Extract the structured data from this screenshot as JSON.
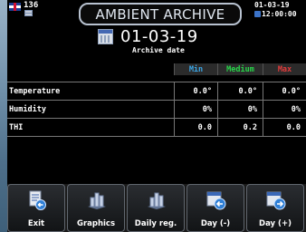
{
  "header": {
    "unit_number": "136",
    "title": "AMBIENT ARCHIVE",
    "date": "01-03-19",
    "time": "12:00:00"
  },
  "archive": {
    "date": "01-03-19",
    "caption": "Archive date"
  },
  "table": {
    "columns": [
      "Min",
      "Medium",
      "Max"
    ],
    "column_colors": [
      "#3aa6e6",
      "#28d64a",
      "#e23b3b"
    ],
    "rows": [
      {
        "label": "Temperature",
        "min": "0.0°",
        "medium": "0.0°",
        "max": "0.0°"
      },
      {
        "label": "Humidity",
        "min": "0%",
        "medium": "0%",
        "max": "0%"
      },
      {
        "label": "THI",
        "min": "0.0",
        "medium": "0.2",
        "max": "0.0"
      }
    ]
  },
  "toolbar": {
    "buttons": [
      {
        "label": "Exit",
        "icon": "exit-document-icon"
      },
      {
        "label": "Graphics",
        "icon": "graphics-bars-icon"
      },
      {
        "label": "Daily reg.",
        "icon": "daily-register-bars-icon"
      },
      {
        "label": "Day (-)",
        "icon": "day-previous-icon"
      },
      {
        "label": "Day (+)",
        "icon": "day-next-icon"
      }
    ]
  }
}
